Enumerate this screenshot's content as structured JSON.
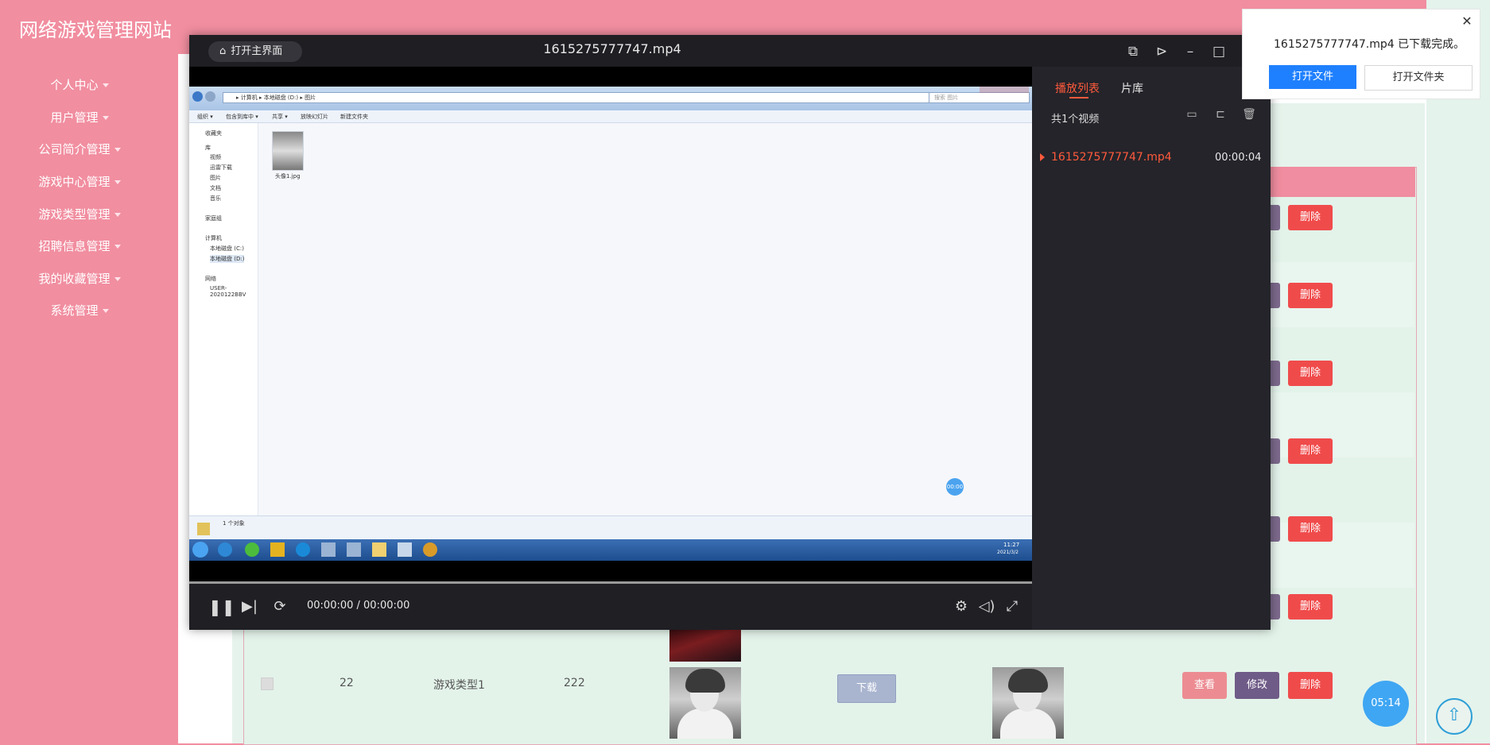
{
  "site": {
    "title": "网络游戏管理网站"
  },
  "sidebar": {
    "items": [
      {
        "label": "个人中心"
      },
      {
        "label": "用户管理"
      },
      {
        "label": "公司简介管理"
      },
      {
        "label": "游戏中心管理"
      },
      {
        "label": "游戏类型管理"
      },
      {
        "label": "招聘信息管理"
      },
      {
        "label": "我的收藏管理"
      },
      {
        "label": "系统管理"
      }
    ]
  },
  "table": {
    "row_delete_label": "删除",
    "last_row": {
      "id": "22",
      "type": "游戏类型1",
      "value": "222",
      "download_label": "下载",
      "view_label": "查看",
      "edit_label": "修改",
      "delete_label": "删除"
    }
  },
  "player": {
    "home_label": "打开主界面",
    "title": "1615275777747.mp4",
    "time": "00:00:00 / 00:00:00",
    "playlist_tab": "播放列表",
    "library_tab": "片库",
    "count": "共1个视频",
    "items": [
      {
        "name": "1615275777747.mp4",
        "duration": "00:00:04"
      }
    ],
    "video_badge": "00:00"
  },
  "win7": {
    "breadcrumb": "▸ 计算机 ▸ 本地磁盘 (D:) ▸ 图片",
    "search_placeholder": "搜索 图片",
    "toolbar": [
      "组织 ▾",
      "包含到库中 ▾",
      "共享 ▾",
      "放映幻灯片",
      "新建文件夹"
    ],
    "tree": [
      "收藏夹",
      "库",
      "视频",
      "迅雷下载",
      "图片",
      "文档",
      "音乐",
      "家庭组",
      "计算机",
      "本地磁盘 (C:)",
      "本地磁盘 (D:)",
      "网络",
      "USER-2020122BBV"
    ],
    "file": "头像1.jpg",
    "status": "1 个对象",
    "clock_time": "11:27",
    "clock_date": "2021/3/2"
  },
  "download": {
    "message": "1615275777747.mp4 已下载完成。",
    "open_file": "打开文件",
    "open_folder": "打开文件夹"
  },
  "float": {
    "time": "05:14"
  },
  "colors": {
    "sidebar_bg": "#f18ea0",
    "delete_btn": "#f04b4b",
    "accent": "#ff5a3c",
    "primary": "#1f80ff"
  }
}
